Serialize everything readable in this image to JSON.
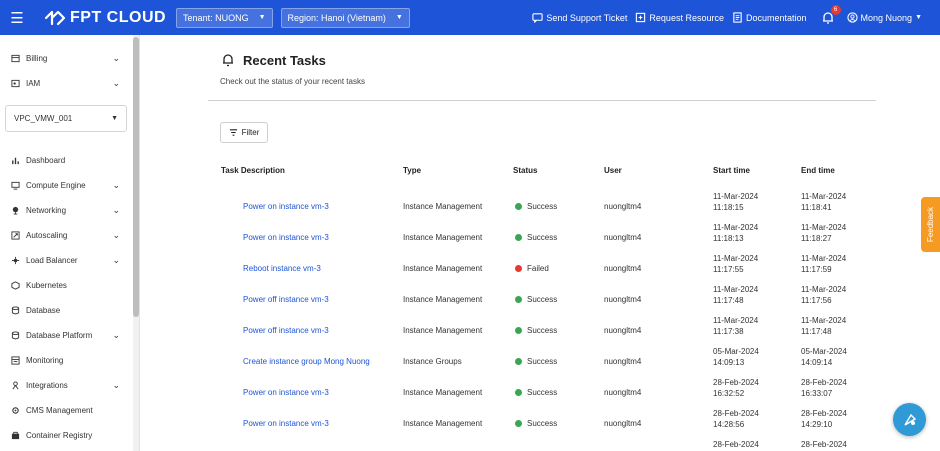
{
  "topbar": {
    "logo_text": "FPT CLOUD",
    "tenant_label": "Tenant: NUONG",
    "region_label": "Region: Hanoi (Vietnam)",
    "send_support": "Send Support Ticket",
    "request_resource": "Request Resource",
    "documentation": "Documentation",
    "notification_count": "6",
    "user_name": "Mong Nuong",
    "bg_color": "#1e54d8"
  },
  "sidebar": {
    "vpc_selected": "VPC_VMW_001",
    "top_items": [
      {
        "label": "Billing",
        "icon": "billing-icon"
      },
      {
        "label": "IAM",
        "icon": "iam-icon"
      }
    ],
    "items": [
      {
        "label": "Dashboard",
        "icon": "chart-icon",
        "expandable": false
      },
      {
        "label": "Compute Engine",
        "icon": "monitor-icon",
        "expandable": true
      },
      {
        "label": "Networking",
        "icon": "network-icon",
        "expandable": true
      },
      {
        "label": "Autoscaling",
        "icon": "autoscaling-icon",
        "expandable": true
      },
      {
        "label": "Load Balancer",
        "icon": "load-balancer-icon",
        "expandable": true
      },
      {
        "label": "Kubernetes",
        "icon": "kubernetes-icon",
        "expandable": false
      },
      {
        "label": "Database",
        "icon": "database-icon",
        "expandable": false
      },
      {
        "label": "Database Platform",
        "icon": "database-icon",
        "expandable": true
      },
      {
        "label": "Monitoring",
        "icon": "monitoring-icon",
        "expandable": false
      },
      {
        "label": "Integrations",
        "icon": "integrations-icon",
        "expandable": true
      },
      {
        "label": "CMS Management",
        "icon": "cms-icon",
        "expandable": false
      },
      {
        "label": "Container Registry",
        "icon": "container-icon",
        "expandable": false
      }
    ]
  },
  "main": {
    "title": "Recent Tasks",
    "subtitle": "Check out the status of your recent tasks",
    "filter_label": "Filter",
    "columns": [
      "Task Description",
      "Type",
      "Status",
      "User",
      "Start time",
      "End time"
    ],
    "rows": [
      {
        "desc": "Power on instance vm-3",
        "type": "Instance Management",
        "status": "Success",
        "user": "nuongltm4",
        "start_date": "11-Mar-2024",
        "start_time": "11:18:15",
        "end_date": "11-Mar-2024",
        "end_time": "11:18:41"
      },
      {
        "desc": "Power on instance vm-3",
        "type": "Instance Management",
        "status": "Success",
        "user": "nuongltm4",
        "start_date": "11-Mar-2024",
        "start_time": "11:18:13",
        "end_date": "11-Mar-2024",
        "end_time": "11:18:27"
      },
      {
        "desc": "Reboot instance vm-3",
        "type": "Instance Management",
        "status": "Failed",
        "user": "nuongltm4",
        "start_date": "11-Mar-2024",
        "start_time": "11:17:55",
        "end_date": "11-Mar-2024",
        "end_time": "11:17:59"
      },
      {
        "desc": "Power off instance vm-3",
        "type": "Instance Management",
        "status": "Success",
        "user": "nuongltm4",
        "start_date": "11-Mar-2024",
        "start_time": "11:17:48",
        "end_date": "11-Mar-2024",
        "end_time": "11:17:56"
      },
      {
        "desc": "Power off instance vm-3",
        "type": "Instance Management",
        "status": "Success",
        "user": "nuongltm4",
        "start_date": "11-Mar-2024",
        "start_time": "11:17:38",
        "end_date": "11-Mar-2024",
        "end_time": "11:17:48"
      },
      {
        "desc": "Create instance group Mong Nuong",
        "type": "Instance Groups",
        "status": "Success",
        "user": "nuongltm4",
        "start_date": "05-Mar-2024",
        "start_time": "14:09:13",
        "end_date": "05-Mar-2024",
        "end_time": "14:09:14"
      },
      {
        "desc": "Power on instance vm-3",
        "type": "Instance Management",
        "status": "Success",
        "user": "nuongltm4",
        "start_date": "28-Feb-2024",
        "start_time": "16:32:52",
        "end_date": "28-Feb-2024",
        "end_time": "16:33:07"
      },
      {
        "desc": "Power on instance vm-3",
        "type": "Instance Management",
        "status": "Success",
        "user": "nuongltm4",
        "start_date": "28-Feb-2024",
        "start_time": "14:28:56",
        "end_date": "28-Feb-2024",
        "end_time": "14:29:10"
      },
      {
        "desc": "",
        "type": "",
        "status": "",
        "user": "",
        "start_date": "28-Feb-2024",
        "start_time": "",
        "end_date": "28-Feb-2024",
        "end_time": ""
      }
    ],
    "status_colors": {
      "Success": "#3aa655",
      "Failed": "#e53935"
    }
  },
  "feedback_label": "Feedback"
}
